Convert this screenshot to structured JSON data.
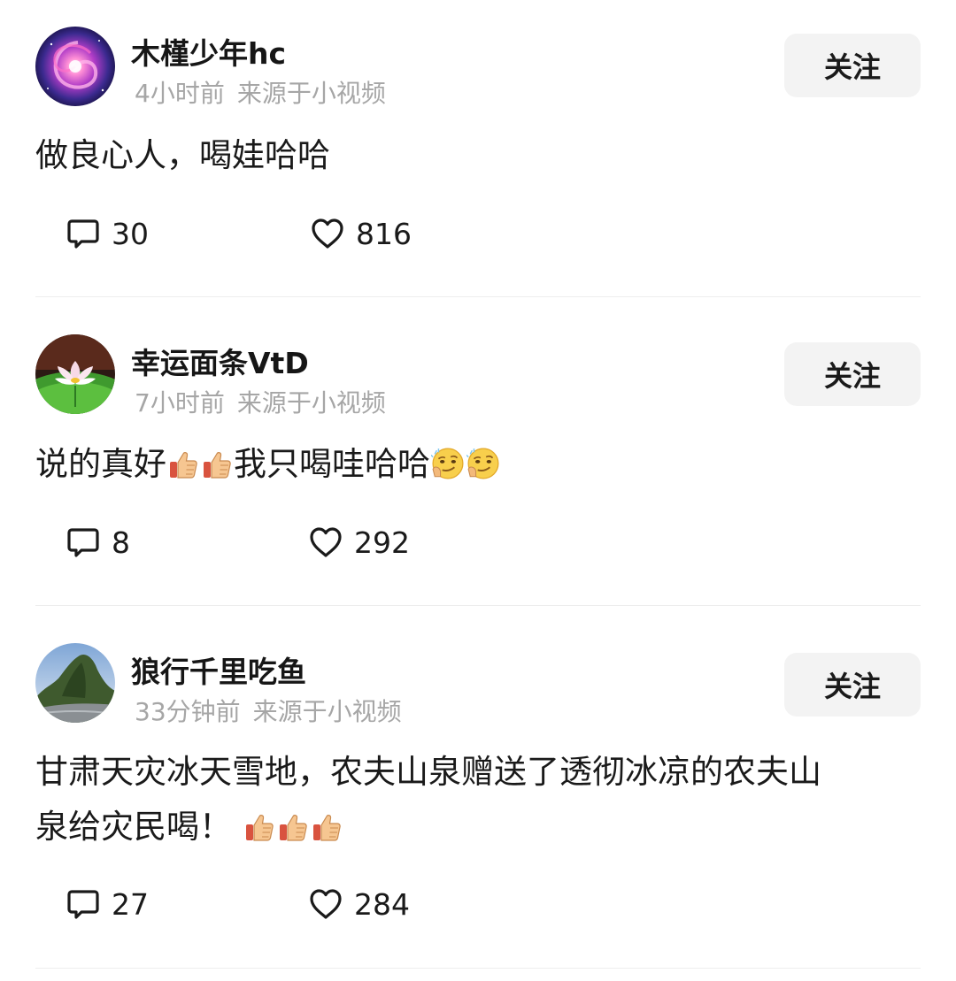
{
  "comments": [
    {
      "username": "木槿少年hc",
      "time": "4小时前",
      "source": "来源于小视频",
      "follow_label": "关注",
      "text": "做良心人，喝娃哈哈",
      "reply_count": "30",
      "like_count": "816"
    },
    {
      "username": "幸运面条VtD",
      "time": "7小时前",
      "source": "来源于小视频",
      "follow_label": "关注",
      "text_a": "说的真好",
      "text_b": "我只喝哇哈哈",
      "reply_count": "8",
      "like_count": "292"
    },
    {
      "username": "狼行千里吃鱼",
      "time": "33分钟前",
      "source": "来源于小视频",
      "follow_label": "关注",
      "text_line1": "甘肃天灾冰天雪地，农夫山泉赠送了透彻冰凉的农夫山",
      "text_line2": "泉给灾民喝！",
      "reply_count": "27",
      "like_count": "284"
    }
  ],
  "icons": {
    "reply": "comment-bubble-icon",
    "like": "heart-icon",
    "thumbs_up": "thumbs-up-emoji",
    "smirk": "smirk-emoji"
  },
  "colors": {
    "text": "#1a1a1a",
    "meta": "#a6a6a6",
    "follow_bg": "#f3f3f3",
    "divider": "#ededed"
  }
}
